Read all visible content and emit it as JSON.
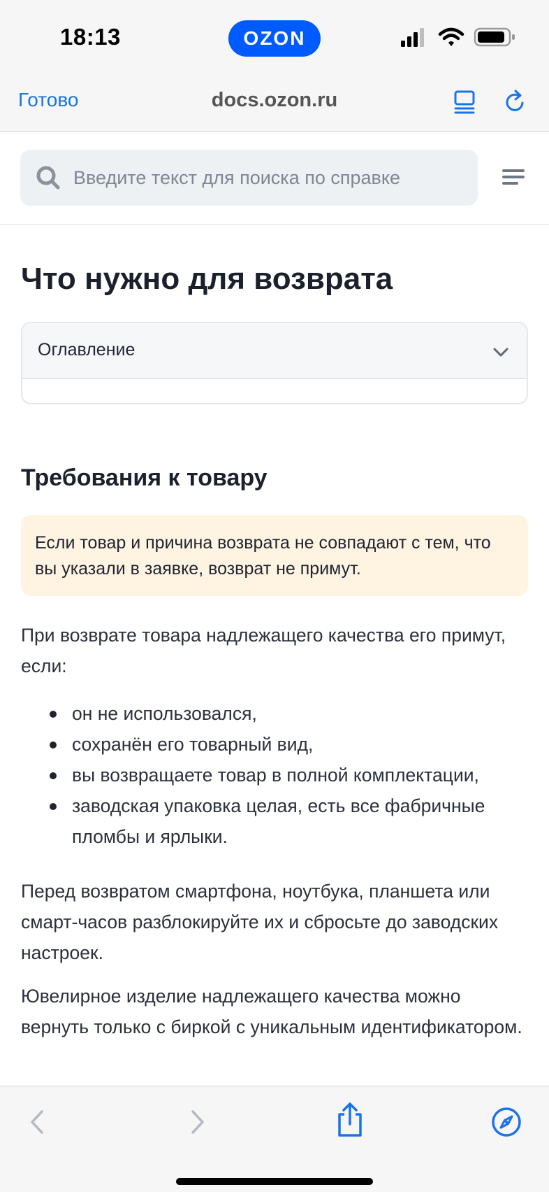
{
  "status_bar": {
    "time": "18:13",
    "brand": "OZON",
    "icons": [
      "cellular-signal-icon",
      "wifi-icon",
      "battery-icon"
    ]
  },
  "browser": {
    "done_label": "Готово",
    "url": "docs.ozon.ru",
    "icons": [
      "reader-mode-icon",
      "reload-icon"
    ]
  },
  "search": {
    "placeholder": "Введите текст для поиска по справке"
  },
  "page": {
    "title": "Что нужно для возврата",
    "toc_label": "Оглавление",
    "section_title": "Требования к товару",
    "warning": "Если товар и причина возврата не совпадают с тем, что вы указали в заявке, возврат не примут.",
    "paragraph_1": "При возврате товара надлежащего качества его примут, если:",
    "bullets": [
      "он не использовался,",
      "сохранён его товарный вид,",
      "вы возвращаете товар в полной комплектации,",
      "заводская упаковка целая, есть все фабричные пломбы и ярлыки."
    ],
    "paragraph_2": "Перед возвратом смартфона, ноутбука, планшета или смарт-часов разблокируйте их и сбросьте до заводских настроек.",
    "paragraph_3": "Ювелирное изделие надлежащего качества можно вернуть только с биркой с уникальным идентификатором."
  },
  "toolbar": {
    "icons": [
      "back-icon",
      "forward-icon",
      "share-icon",
      "safari-compass-icon"
    ]
  },
  "colors": {
    "accent": "#1a73e8",
    "brand": "#005bff",
    "warning_bg": "#fff4e2"
  }
}
